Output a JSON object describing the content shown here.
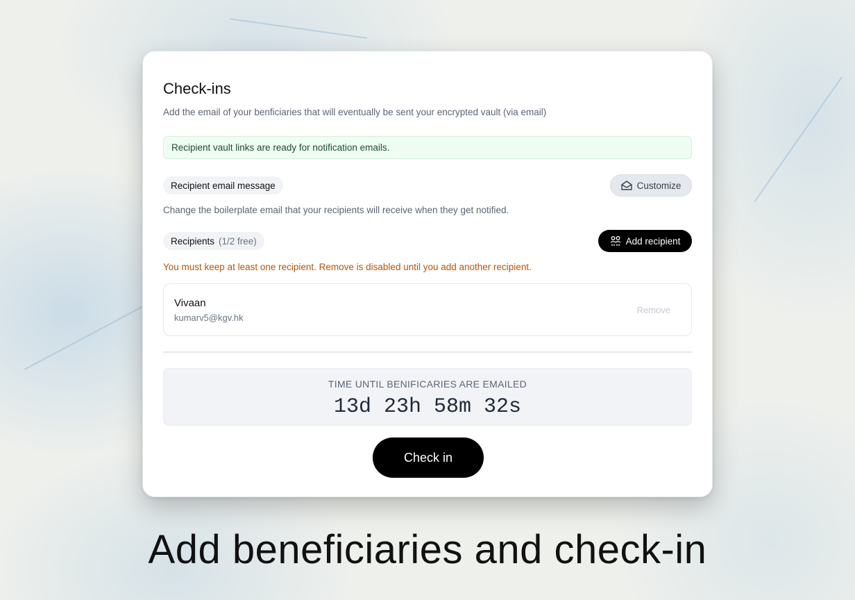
{
  "card": {
    "title": "Check-ins",
    "subtitle": "Add the email of your benficiaries that will eventually be sent your encrypted vault (via email)",
    "notice": "Recipient vault links are ready for notification emails."
  },
  "email_message": {
    "pill_label": "Recipient email message",
    "customize_label": "Customize",
    "description": "Change the boilerplate email that your recipients will receive when they get notified."
  },
  "recipients": {
    "pill_label": "Recipients",
    "pill_count": "(1/2 free)",
    "add_label": "Add recipient",
    "warning": "You must keep at least one recipient. Remove is disabled until you add another recipient.",
    "items": [
      {
        "name": "Vivaan",
        "email": "kumarv5@kgv.hk",
        "remove_label": "Remove"
      }
    ]
  },
  "timer": {
    "label": "TIME UNTIL BENIFICARIES ARE EMAILED",
    "value": "13d 23h 58m 32s"
  },
  "checkin_label": "Check in",
  "caption": "Add beneficiaries and check-in",
  "colors": {
    "notice_bg": "#eefcf2",
    "warning": "#b45309",
    "primary_button": "#000000"
  }
}
